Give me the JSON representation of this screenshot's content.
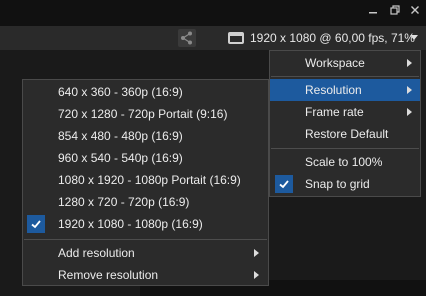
{
  "toolbar": {
    "status_text": "1920 x 1080 @ 60,00 fps, 71%"
  },
  "view_menu": {
    "items": [
      {
        "label": "Workspace",
        "has_submenu": true
      },
      {
        "label": "Resolution",
        "has_submenu": true,
        "active": true
      },
      {
        "label": "Frame rate",
        "has_submenu": true
      },
      {
        "label": "Restore Default"
      },
      {
        "label": "Scale to 100%"
      },
      {
        "label": "Snap to grid",
        "checked": true
      }
    ]
  },
  "resolution_menu": {
    "items": [
      {
        "label": "640 x 360 - 360p (16:9)"
      },
      {
        "label": "720 x 1280 - 720p Portait (9:16)"
      },
      {
        "label": "854 x 480 - 480p (16:9)"
      },
      {
        "label": "960 x 540 - 540p (16:9)"
      },
      {
        "label": "1080 x 1920 - 1080p Portait (16:9)"
      },
      {
        "label": "1280 x 720 - 720p (16:9)"
      },
      {
        "label": "1920 x 1080 - 1080p (16:9)",
        "checked": true
      }
    ],
    "actions": [
      {
        "label": "Add resolution",
        "has_submenu": true
      },
      {
        "label": "Remove resolution",
        "has_submenu": true
      }
    ]
  },
  "colors": {
    "highlight": "#1d5a9e",
    "menu_bg": "#2b2b2b"
  }
}
